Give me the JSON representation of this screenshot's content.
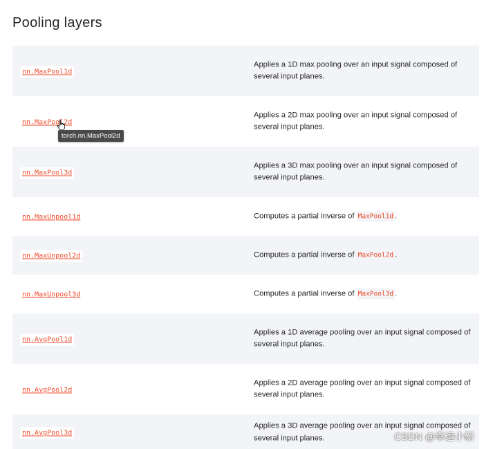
{
  "section": {
    "title": "Pooling layers"
  },
  "rows": [
    {
      "name": "nn.MaxPool1d",
      "desc_parts": [
        "Applies a 1D max pooling over an input signal composed of several input planes."
      ]
    },
    {
      "name": "nn.MaxPool2d",
      "desc_parts": [
        "Applies a 2D max pooling over an input signal composed of several input planes."
      ]
    },
    {
      "name": "nn.MaxPool3d",
      "desc_parts": [
        "Applies a 3D max pooling over an input signal composed of several input planes."
      ]
    },
    {
      "name": "nn.MaxUnpool1d",
      "desc_prefix": "Computes a partial inverse of ",
      "desc_code": "MaxPool1d",
      "desc_suffix": "."
    },
    {
      "name": "nn.MaxUnpool2d",
      "desc_prefix": "Computes a partial inverse of ",
      "desc_code": "MaxPool2d",
      "desc_suffix": "."
    },
    {
      "name": "nn.MaxUnpool3d",
      "desc_prefix": "Computes a partial inverse of ",
      "desc_code": "MaxPool3d",
      "desc_suffix": "."
    },
    {
      "name": "nn.AvgPool1d",
      "desc_parts": [
        "Applies a 1D average pooling over an input signal composed of several input planes."
      ]
    },
    {
      "name": "nn.AvgPool2d",
      "desc_parts": [
        "Applies a 2D average pooling over an input signal composed of several input planes."
      ]
    },
    {
      "name": "nn.AvgPool3d",
      "desc_parts": [
        "Applies a 3D average pooling over an input signal composed of several input planes."
      ]
    }
  ],
  "tooltip": {
    "text": "torch.nn.MaxPool2d"
  },
  "watermark": {
    "text": "CSDN @幸运小新"
  },
  "colors": {
    "code_red": "#ee4c2c",
    "row_shade": "#f3f4f7",
    "text": "#262626"
  }
}
